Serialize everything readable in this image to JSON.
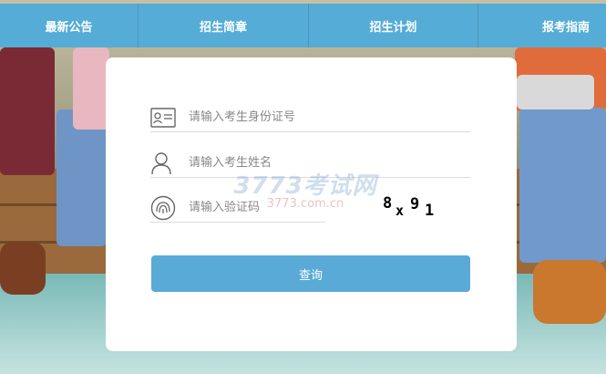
{
  "nav": {
    "items": [
      {
        "label": "最新公告"
      },
      {
        "label": "招生简章"
      },
      {
        "label": "招生计划"
      },
      {
        "label": "报考指南"
      }
    ]
  },
  "form": {
    "id_placeholder": "请输入考生身份证号",
    "name_placeholder": "请输入考生姓名",
    "code_placeholder": "请输入验证码",
    "captcha_chars": [
      "8",
      "x",
      "9",
      "1"
    ],
    "submit_label": "查询"
  },
  "watermark": {
    "main": "3773考试网",
    "sub": "3773.com.cn"
  },
  "colors": {
    "nav": "#55acd6",
    "button": "#5aaad7"
  }
}
